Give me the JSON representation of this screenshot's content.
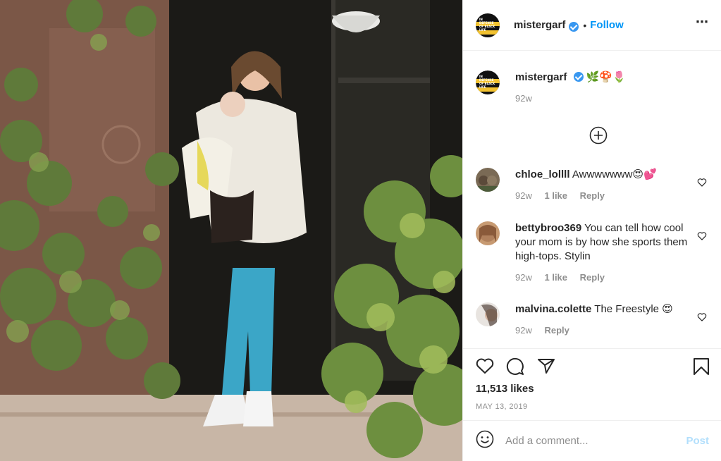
{
  "post": {
    "username": "mistergarf",
    "follow_label": "Follow",
    "separator": "•",
    "more_icon": "⋯",
    "caption_emoji": "🌿🍄🌷",
    "caption_age": "92w",
    "likes": "11,513 likes",
    "date": "MAY 13, 2019",
    "logo_text": "IN DEFENSE OF BLACK LIFE"
  },
  "comments": [
    {
      "username": "chloe_lollll",
      "text": "Awwwwwww😍💕",
      "age": "92w",
      "likes": "1 like",
      "reply": "Reply"
    },
    {
      "username": "bettybroo369",
      "text": "You can tell how cool your mom is by how she sports them high-tops. Stylin",
      "age": "92w",
      "likes": "1 like",
      "reply": "Reply"
    },
    {
      "username": "malvina.colette",
      "text": "The Freestyle 😍",
      "age": "92w",
      "likes": "",
      "reply": "Reply"
    }
  ],
  "add_comment": {
    "placeholder": "Add a comment...",
    "post_label": "Post"
  },
  "colors": {
    "accent": "#0095f6",
    "verified": "#3897f0",
    "post_disabled": "#b2dffc",
    "muted": "#8e8e8e",
    "border": "#efefef"
  },
  "icons": [
    "verified-badge-icon",
    "more-options-icon",
    "load-more-icon",
    "heart-icon",
    "comment-icon",
    "share-icon",
    "save-icon",
    "emoji-icon"
  ]
}
